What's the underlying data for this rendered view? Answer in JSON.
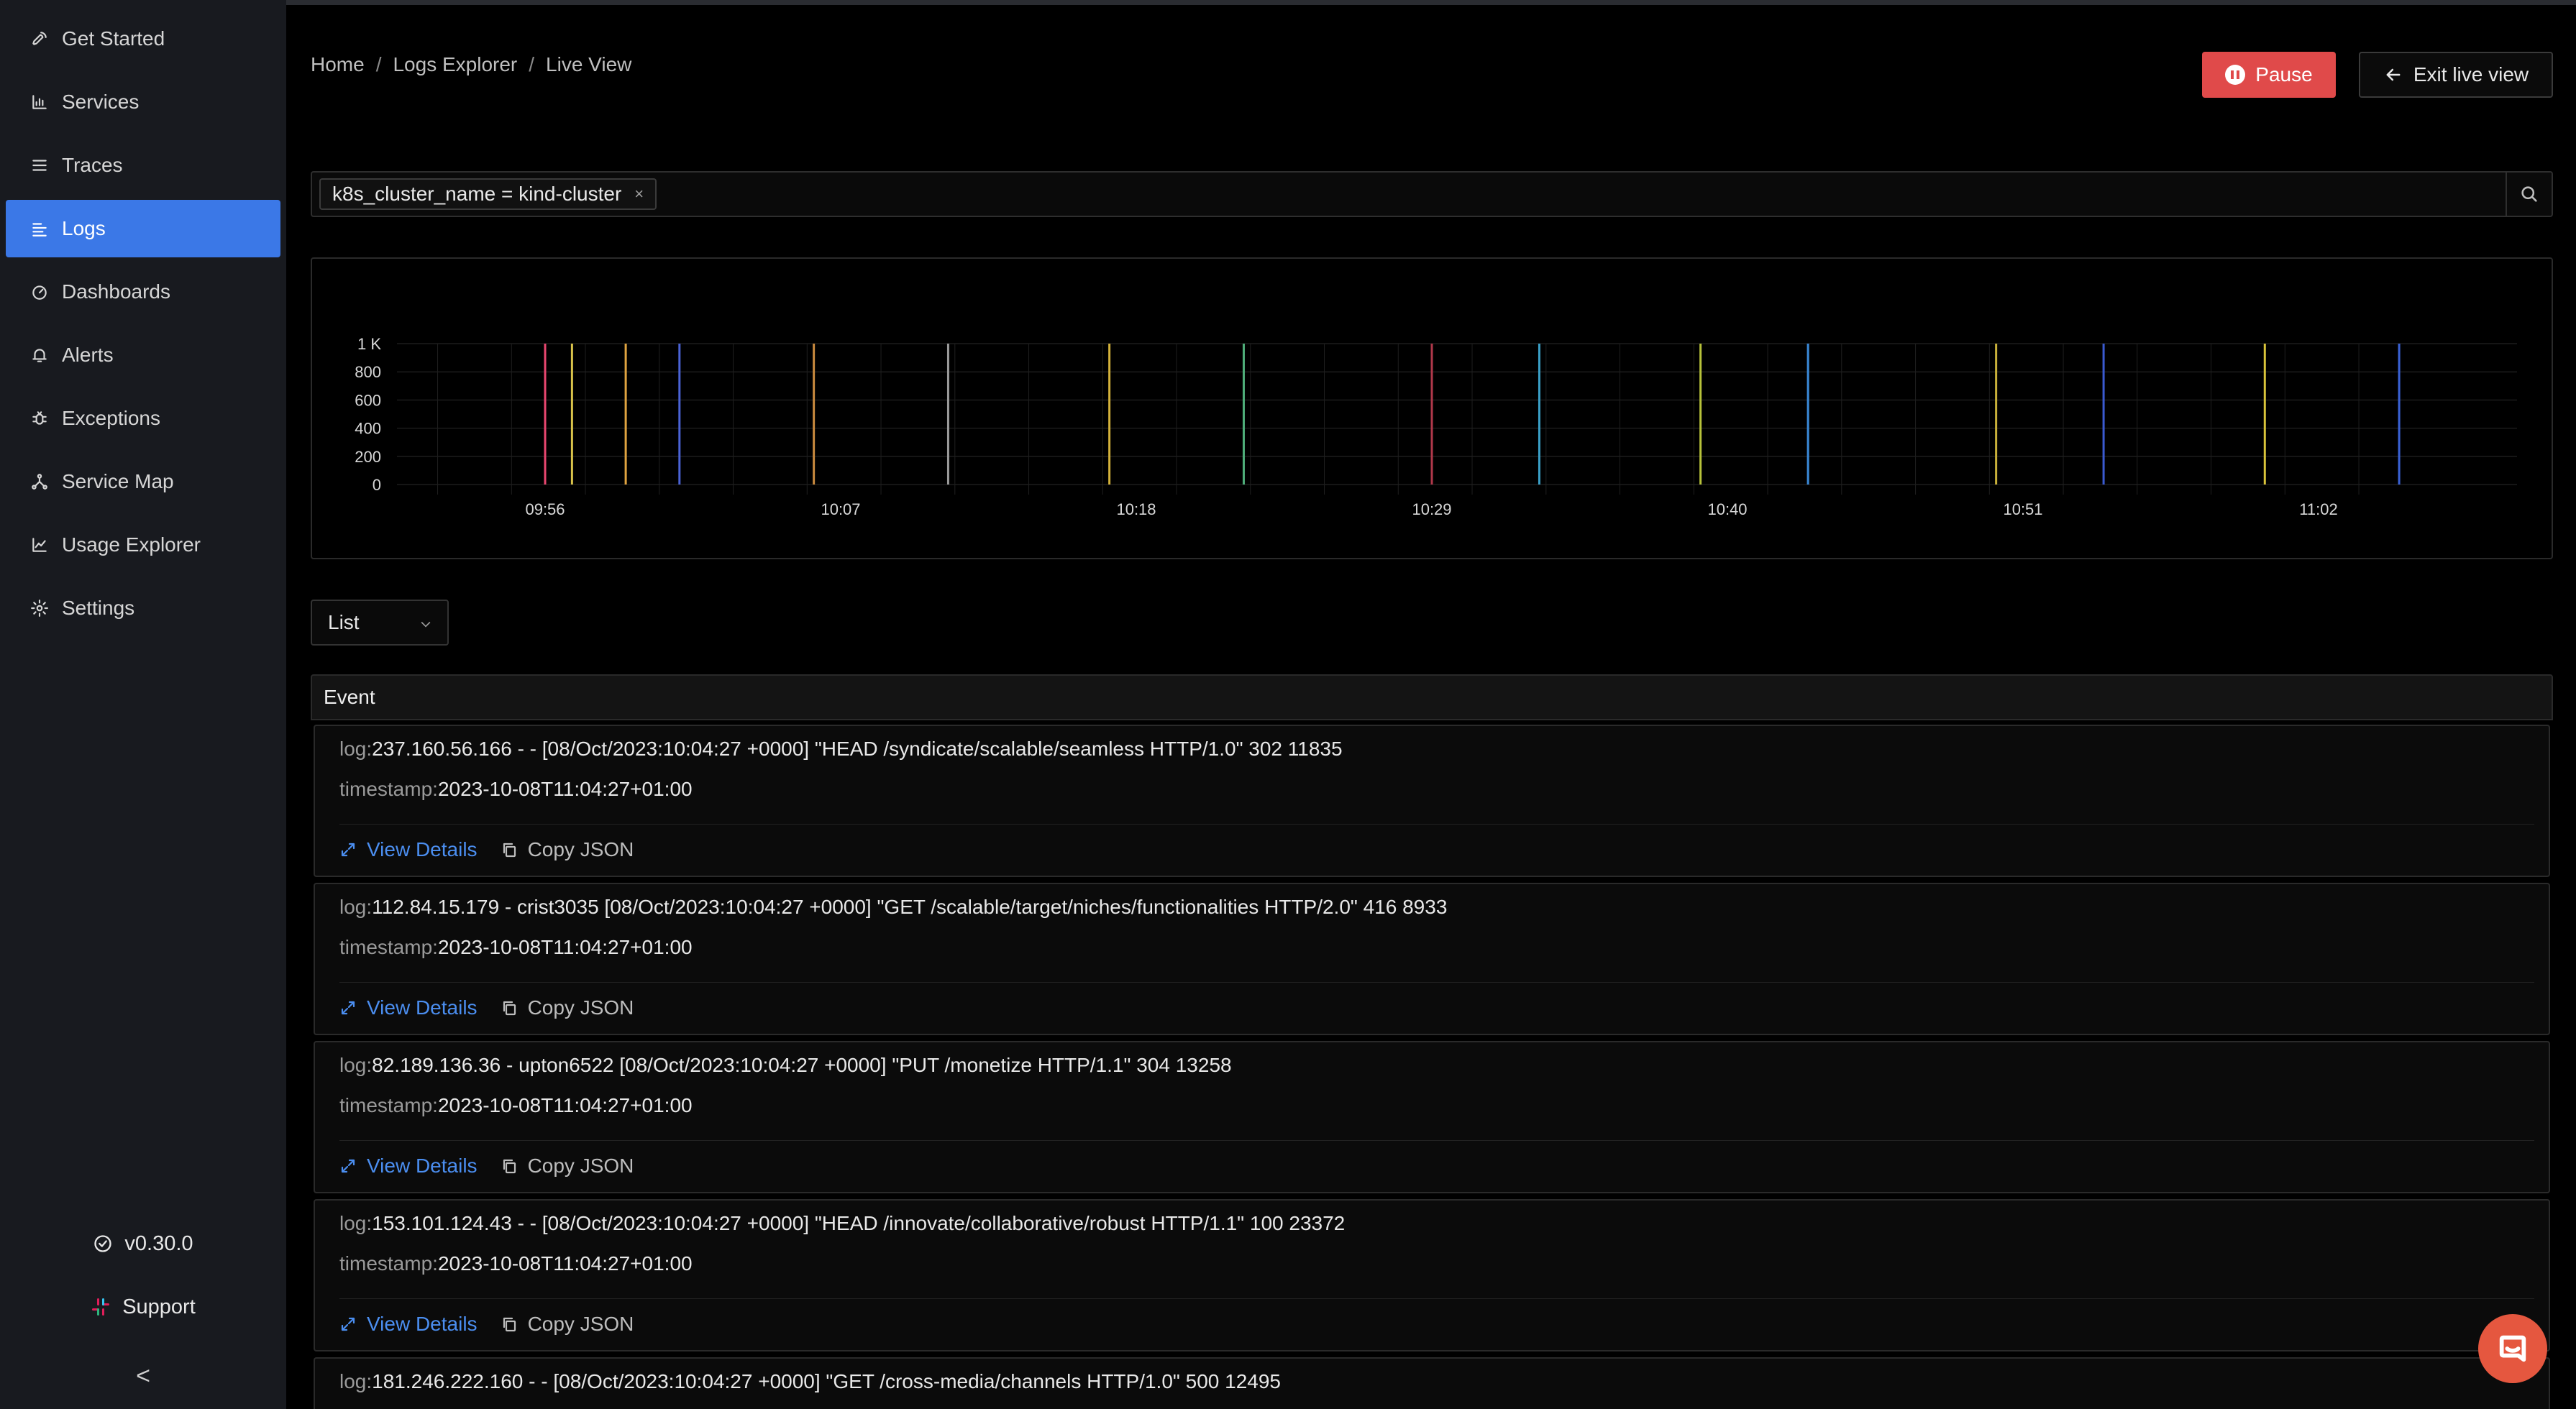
{
  "sidebar": {
    "items": [
      {
        "label": "Get Started",
        "icon": "rocket-icon"
      },
      {
        "label": "Services",
        "icon": "bar-chart-icon"
      },
      {
        "label": "Traces",
        "icon": "list-icon"
      },
      {
        "label": "Logs",
        "icon": "logs-icon",
        "active": true
      },
      {
        "label": "Dashboards",
        "icon": "dashboard-icon"
      },
      {
        "label": "Alerts",
        "icon": "bell-icon"
      },
      {
        "label": "Exceptions",
        "icon": "bug-icon"
      },
      {
        "label": "Service Map",
        "icon": "network-icon"
      },
      {
        "label": "Usage Explorer",
        "icon": "line-chart-icon"
      },
      {
        "label": "Settings",
        "icon": "gear-icon"
      }
    ],
    "version": "v0.30.0",
    "support": "Support",
    "collapse_glyph": "<"
  },
  "breadcrumb": [
    "Home",
    "Logs Explorer",
    "Live View"
  ],
  "breadcrumb_sep": "/",
  "header": {
    "pause_label": "Pause",
    "exit_label": "Exit live view"
  },
  "search": {
    "chip": "k8s_cluster_name = kind-cluster",
    "chip_remove": "×"
  },
  "chart_data": {
    "type": "bar",
    "title": "",
    "xlabel": "",
    "ylabel": "",
    "y_ticks": [
      "1 K",
      "800",
      "600",
      "400",
      "200",
      "0"
    ],
    "x_ticks": [
      "09:56",
      "10:07",
      "10:18",
      "10:29",
      "10:40",
      "10:51",
      "11:02"
    ],
    "ylim": [
      0,
      1000
    ],
    "grid": true,
    "bars": [
      {
        "x": "09:56",
        "value": 1000,
        "color": "#e8466f"
      },
      {
        "x": "09:57",
        "value": 1000,
        "color": "#d9c34a"
      },
      {
        "x": "09:59",
        "value": 1000,
        "color": "#e0a440"
      },
      {
        "x": "10:01",
        "value": 1000,
        "color": "#4a63d6"
      },
      {
        "x": "10:06",
        "value": 1000,
        "color": "#c98a3e"
      },
      {
        "x": "10:11",
        "value": 1000,
        "color": "#9a9a9a"
      },
      {
        "x": "10:17",
        "value": 1000,
        "color": "#d4b23a"
      },
      {
        "x": "10:22",
        "value": 1000,
        "color": "#4fae7a"
      },
      {
        "x": "10:29",
        "value": 1000,
        "color": "#b0384a"
      },
      {
        "x": "10:33",
        "value": 1000,
        "color": "#3aa0c8"
      },
      {
        "x": "10:39",
        "value": 1000,
        "color": "#b7c23a"
      },
      {
        "x": "10:43",
        "value": 1000,
        "color": "#3a8ad9"
      },
      {
        "x": "10:50",
        "value": 1000,
        "color": "#c9b13a"
      },
      {
        "x": "10:54",
        "value": 1000,
        "color": "#3a5ad0"
      },
      {
        "x": "11:00",
        "value": 1000,
        "color": "#d9c43a"
      },
      {
        "x": "11:05",
        "value": 1000,
        "color": "#3a62d6"
      }
    ]
  },
  "view_select": "List",
  "table": {
    "header": "Event",
    "log_key": "log:",
    "ts_key": "timestamp:",
    "view_details": "View Details",
    "copy_json": "Copy JSON",
    "rows": [
      {
        "log": "237.160.56.166 - - [08/Oct/2023:10:04:27 +0000] \"HEAD /syndicate/scalable/seamless HTTP/1.0\" 302 11835",
        "timestamp": "2023-10-08T11:04:27+01:00"
      },
      {
        "log": "112.84.15.179 - crist3035 [08/Oct/2023:10:04:27 +0000] \"GET /scalable/target/niches/functionalities HTTP/2.0\" 416 8933",
        "timestamp": "2023-10-08T11:04:27+01:00"
      },
      {
        "log": "82.189.136.36 - upton6522 [08/Oct/2023:10:04:27 +0000] \"PUT /monetize HTTP/1.1\" 304 13258",
        "timestamp": "2023-10-08T11:04:27+01:00"
      },
      {
        "log": "153.101.124.43 - - [08/Oct/2023:10:04:27 +0000] \"HEAD /innovate/collaborative/robust HTTP/1.1\" 100 23372",
        "timestamp": "2023-10-08T11:04:27+01:00"
      },
      {
        "log": "181.246.222.160 - - [08/Oct/2023:10:04:27 +0000] \"GET /cross-media/channels HTTP/1.0\" 500 12495",
        "timestamp": ""
      }
    ]
  }
}
